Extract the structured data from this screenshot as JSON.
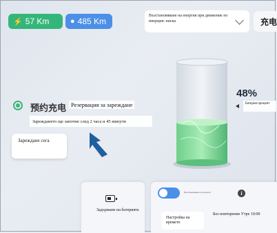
{
  "status_pills": {
    "range": "57 Km",
    "battery": "485 Km"
  },
  "regen": {
    "label": "Възстановяване на енергия при движение по инерция: ниска"
  },
  "tab_charge": {
    "label": "充电"
  },
  "reservation": {
    "label_cn": "预约充电",
    "label": "Резервация за зареждане",
    "start_text": "Зареждането ще започне след 2 часа и 45 минути",
    "charge_now": "Зареждане сега"
  },
  "battery": {
    "percent_text": "48%",
    "percent_value": 0.48,
    "label": "Батерия процент"
  },
  "bottom": {
    "hold_label": "Задържане на батерията",
    "toggle_caption": "Възстановяване на енергия",
    "toggle_on": true,
    "time_setting": "Настройка на времето",
    "repeat_text": "Без повторение Утре 10:00"
  },
  "colors": {
    "green": "#34b67a",
    "blue": "#4c8fe6"
  }
}
